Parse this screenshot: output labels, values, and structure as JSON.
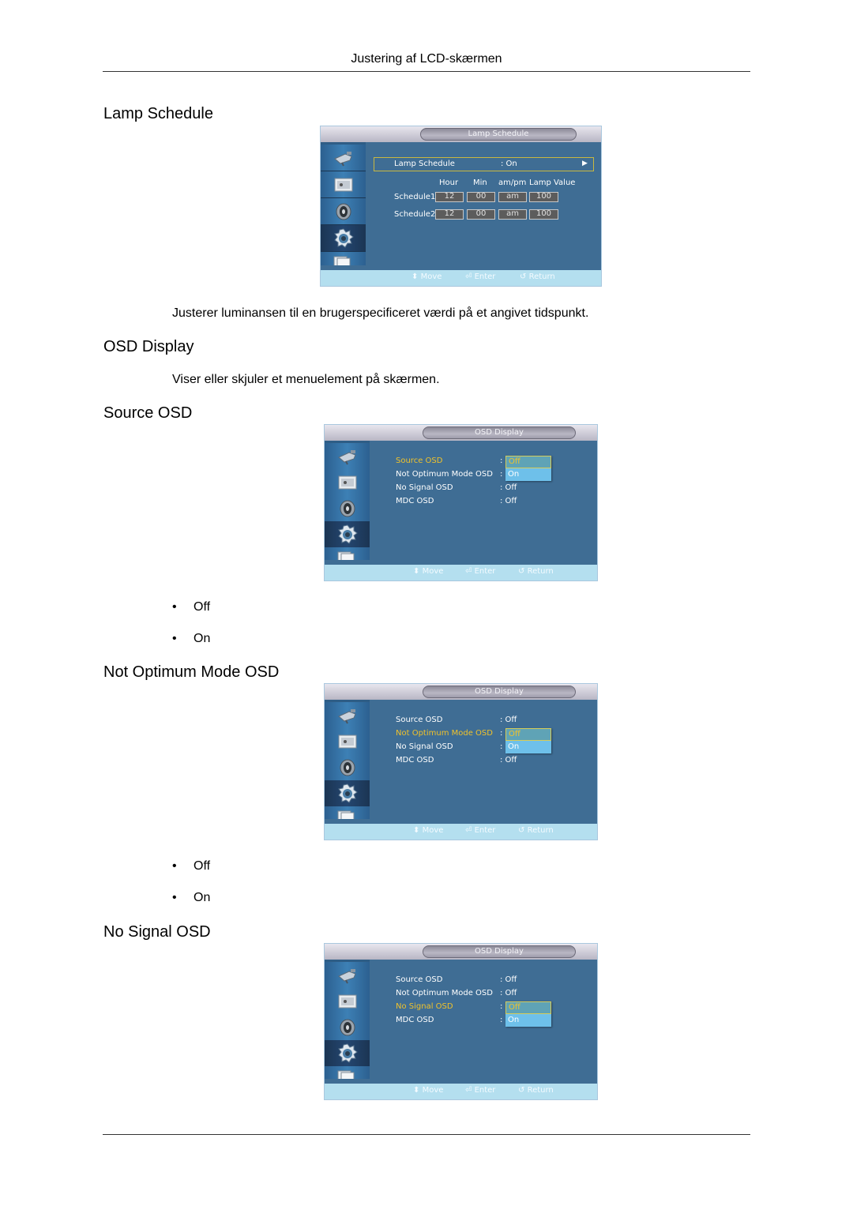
{
  "header": {
    "title": "Justering af LCD-skærmen"
  },
  "sections": {
    "lamp_schedule": {
      "heading": "Lamp Schedule",
      "description": "Justerer luminansen til en brugerspecificeret værdi på et angivet tidspunkt.",
      "osd": {
        "title": "Lamp Schedule",
        "row_label": "Lamp Schedule",
        "row_value": ": On",
        "arrow": "▶",
        "columns": [
          "Hour",
          "Min",
          "am/pm",
          "Lamp Value"
        ],
        "schedules": [
          {
            "label": "Schedule1",
            "hour": "12",
            "min": "00",
            "ampm": "am",
            "lamp_value": "100"
          },
          {
            "label": "Schedule2",
            "hour": "12",
            "min": "00",
            "ampm": "am",
            "lamp_value": "100"
          }
        ]
      }
    },
    "osd_display": {
      "heading": "OSD Display",
      "description": "Viser eller skjuler et menuelement på skærmen."
    },
    "source_osd": {
      "heading": "Source OSD",
      "osd": {
        "title": "OSD Display",
        "items": [
          {
            "label": "Source OSD",
            "value": ": Off"
          },
          {
            "label": "Not Optimum Mode OSD",
            "value": ": Off"
          },
          {
            "label": "No Signal OSD",
            "value": ": Off"
          },
          {
            "label": "MDC OSD",
            "value": ": Off"
          }
        ],
        "selected_index": 0,
        "dropdown": [
          "Off",
          "On"
        ]
      },
      "options": [
        "Off",
        "On"
      ]
    },
    "not_optimum_mode_osd": {
      "heading": "Not Optimum Mode OSD",
      "osd": {
        "title": "OSD Display",
        "items": [
          {
            "label": "Source OSD",
            "value": ": Off"
          },
          {
            "label": "Not Optimum Mode OSD",
            "value": ": Off"
          },
          {
            "label": "No Signal OSD",
            "value": ": Off"
          },
          {
            "label": "MDC OSD",
            "value": ": Off"
          }
        ],
        "selected_index": 1,
        "dropdown": [
          "Off",
          "On"
        ]
      },
      "options": [
        "Off",
        "On"
      ]
    },
    "no_signal_osd": {
      "heading": "No Signal OSD",
      "osd": {
        "title": "OSD Display",
        "items": [
          {
            "label": "Source OSD",
            "value": ": Off"
          },
          {
            "label": "Not Optimum Mode OSD",
            "value": ": Off"
          },
          {
            "label": "No Signal OSD",
            "value": ": Off"
          },
          {
            "label": "MDC OSD",
            "value": ": Off"
          }
        ],
        "selected_index": 2,
        "dropdown": [
          "Off",
          "On"
        ]
      }
    }
  },
  "osd_common": {
    "sidebar_icons": [
      "input-icon",
      "picture-icon",
      "sound-icon",
      "setup-icon",
      "multi-control-icon"
    ],
    "active_sidebar_index": 3,
    "footer": {
      "move": "Move",
      "enter": "Enter",
      "return": "Return"
    },
    "colors": {
      "panel": "#3f6d94",
      "highlight": "#f0c22b",
      "footer": "#b4dfef",
      "dropdown": "#6ec0ea"
    }
  },
  "bullet_glyph": "•"
}
